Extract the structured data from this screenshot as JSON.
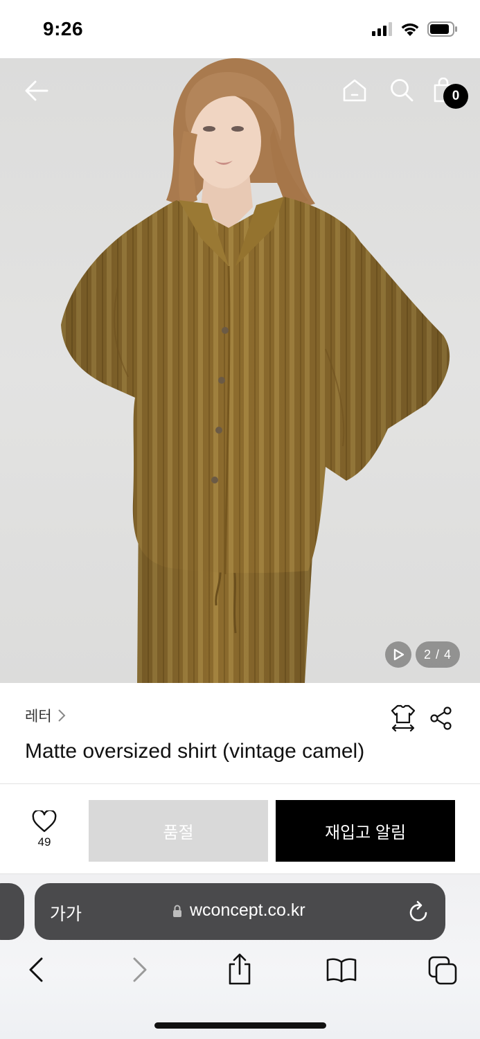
{
  "status_bar": {
    "time": "9:26"
  },
  "header": {
    "cart_count": "0"
  },
  "gallery": {
    "page_indicator": "2 / 4"
  },
  "product": {
    "brand": "레터",
    "title": "Matte oversized shirt (vintage camel)"
  },
  "actions": {
    "like_count": "49",
    "soldout_label": "품절",
    "restock_label": "재입고 알림"
  },
  "browser": {
    "text_size_label": "가가",
    "url": "wconcept.co.kr"
  },
  "colors": {
    "shirt": "#8a6a2c",
    "background": "#dedede",
    "restock_button": "#000000",
    "soldout_button": "#d9d9d9"
  }
}
